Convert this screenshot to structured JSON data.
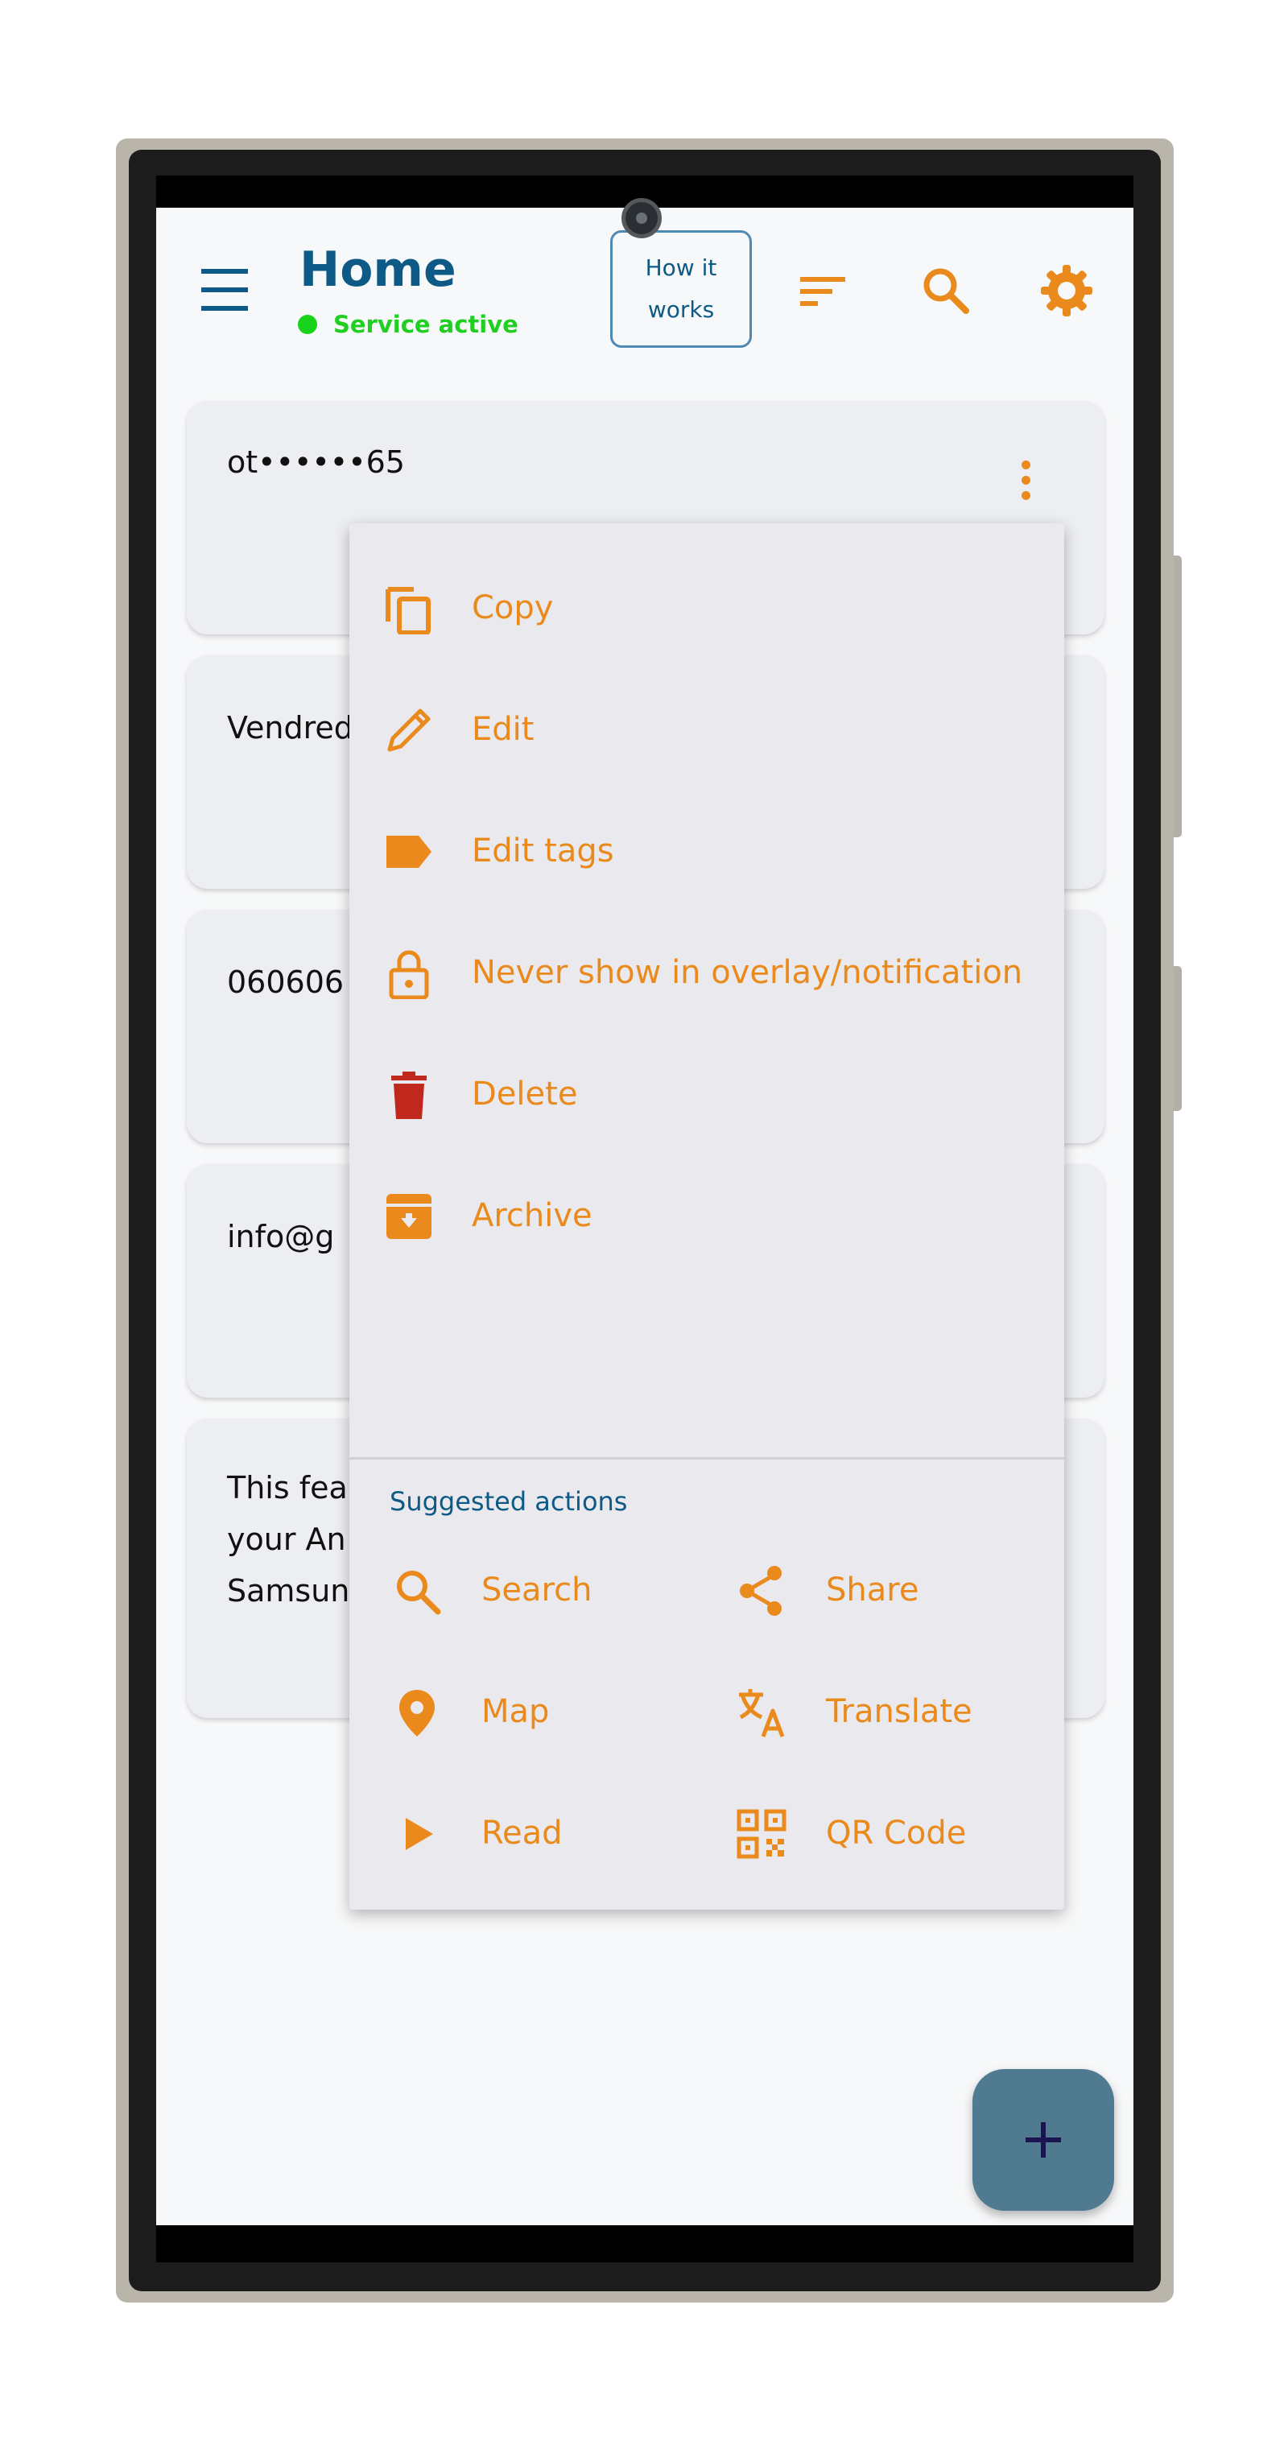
{
  "header": {
    "title": "Home",
    "status_text": "Service active",
    "how_it_works": "How it works"
  },
  "cards": [
    {
      "text": "ot••••••65"
    },
    {
      "text": "Vendred"
    },
    {
      "text": "060606"
    },
    {
      "text": "info@g"
    },
    {
      "text": "This fea\nyour An\nSamsun"
    }
  ],
  "menu": {
    "items": [
      {
        "label": "Copy",
        "icon": "copy-icon"
      },
      {
        "label": "Edit",
        "icon": "pencil-icon"
      },
      {
        "label": "Edit tags",
        "icon": "tag-icon"
      },
      {
        "label": "Never show in overlay/notification",
        "icon": "lock-icon"
      },
      {
        "label": "Delete",
        "icon": "trash-icon"
      },
      {
        "label": "Archive",
        "icon": "archive-icon"
      }
    ],
    "suggested_title": "Suggested actions",
    "suggested": [
      {
        "label": "Search",
        "icon": "search-icon"
      },
      {
        "label": "Share",
        "icon": "share-icon"
      },
      {
        "label": "Map",
        "icon": "map-pin-icon"
      },
      {
        "label": "Translate",
        "icon": "translate-icon"
      },
      {
        "label": "Read",
        "icon": "play-icon"
      },
      {
        "label": "QR Code",
        "icon": "qr-code-icon"
      }
    ]
  },
  "colors": {
    "accent": "#ea8a1c",
    "title": "#0e5a86",
    "status": "#21cf23",
    "delete": "#c0281e",
    "fab": "#507a90"
  }
}
